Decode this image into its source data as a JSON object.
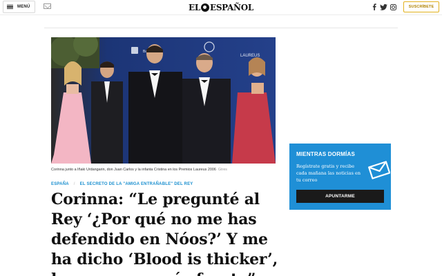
{
  "header": {
    "menu_label": "MENÚ",
    "logo_text_left": "EL",
    "logo_text_right": "ESPAÑOL",
    "subscribe_label": "SUSCRÍBETE",
    "social": [
      "facebook-icon",
      "twitter-icon",
      "instagram-icon"
    ]
  },
  "photo": {
    "backdrop_texts": [
      "Barcelona",
      "LAUREUS"
    ],
    "caption": "Corinna junto a Iñaki Urdangarin, don Juan Carlos y la infanta Cristina en los Premios Laureus 2006",
    "credit": "Gtres"
  },
  "article": {
    "section": "ESPAÑA",
    "tag": "EL SECRETO DE LA \"AMIGA ENTRAÑABLE\" DEL REY",
    "headline": "Corinna: “Le pregunté al Rey ‘¿Por qué no me has defendido en Nóos?’ Y me ha dicho ‘Blood is thicker’, la sangre es más fuerte”"
  },
  "newsletter": {
    "title": "MIENTRAS DORMÍAS",
    "text": "Regístrate gratis y recibe cada mañana las noticias en tu correo",
    "button_label": "APUNTARME"
  },
  "colors": {
    "accent_blue": "#1f8fd6",
    "subscribe_gold": "#e2b11c",
    "tag_blue": "#1a8fcf"
  }
}
